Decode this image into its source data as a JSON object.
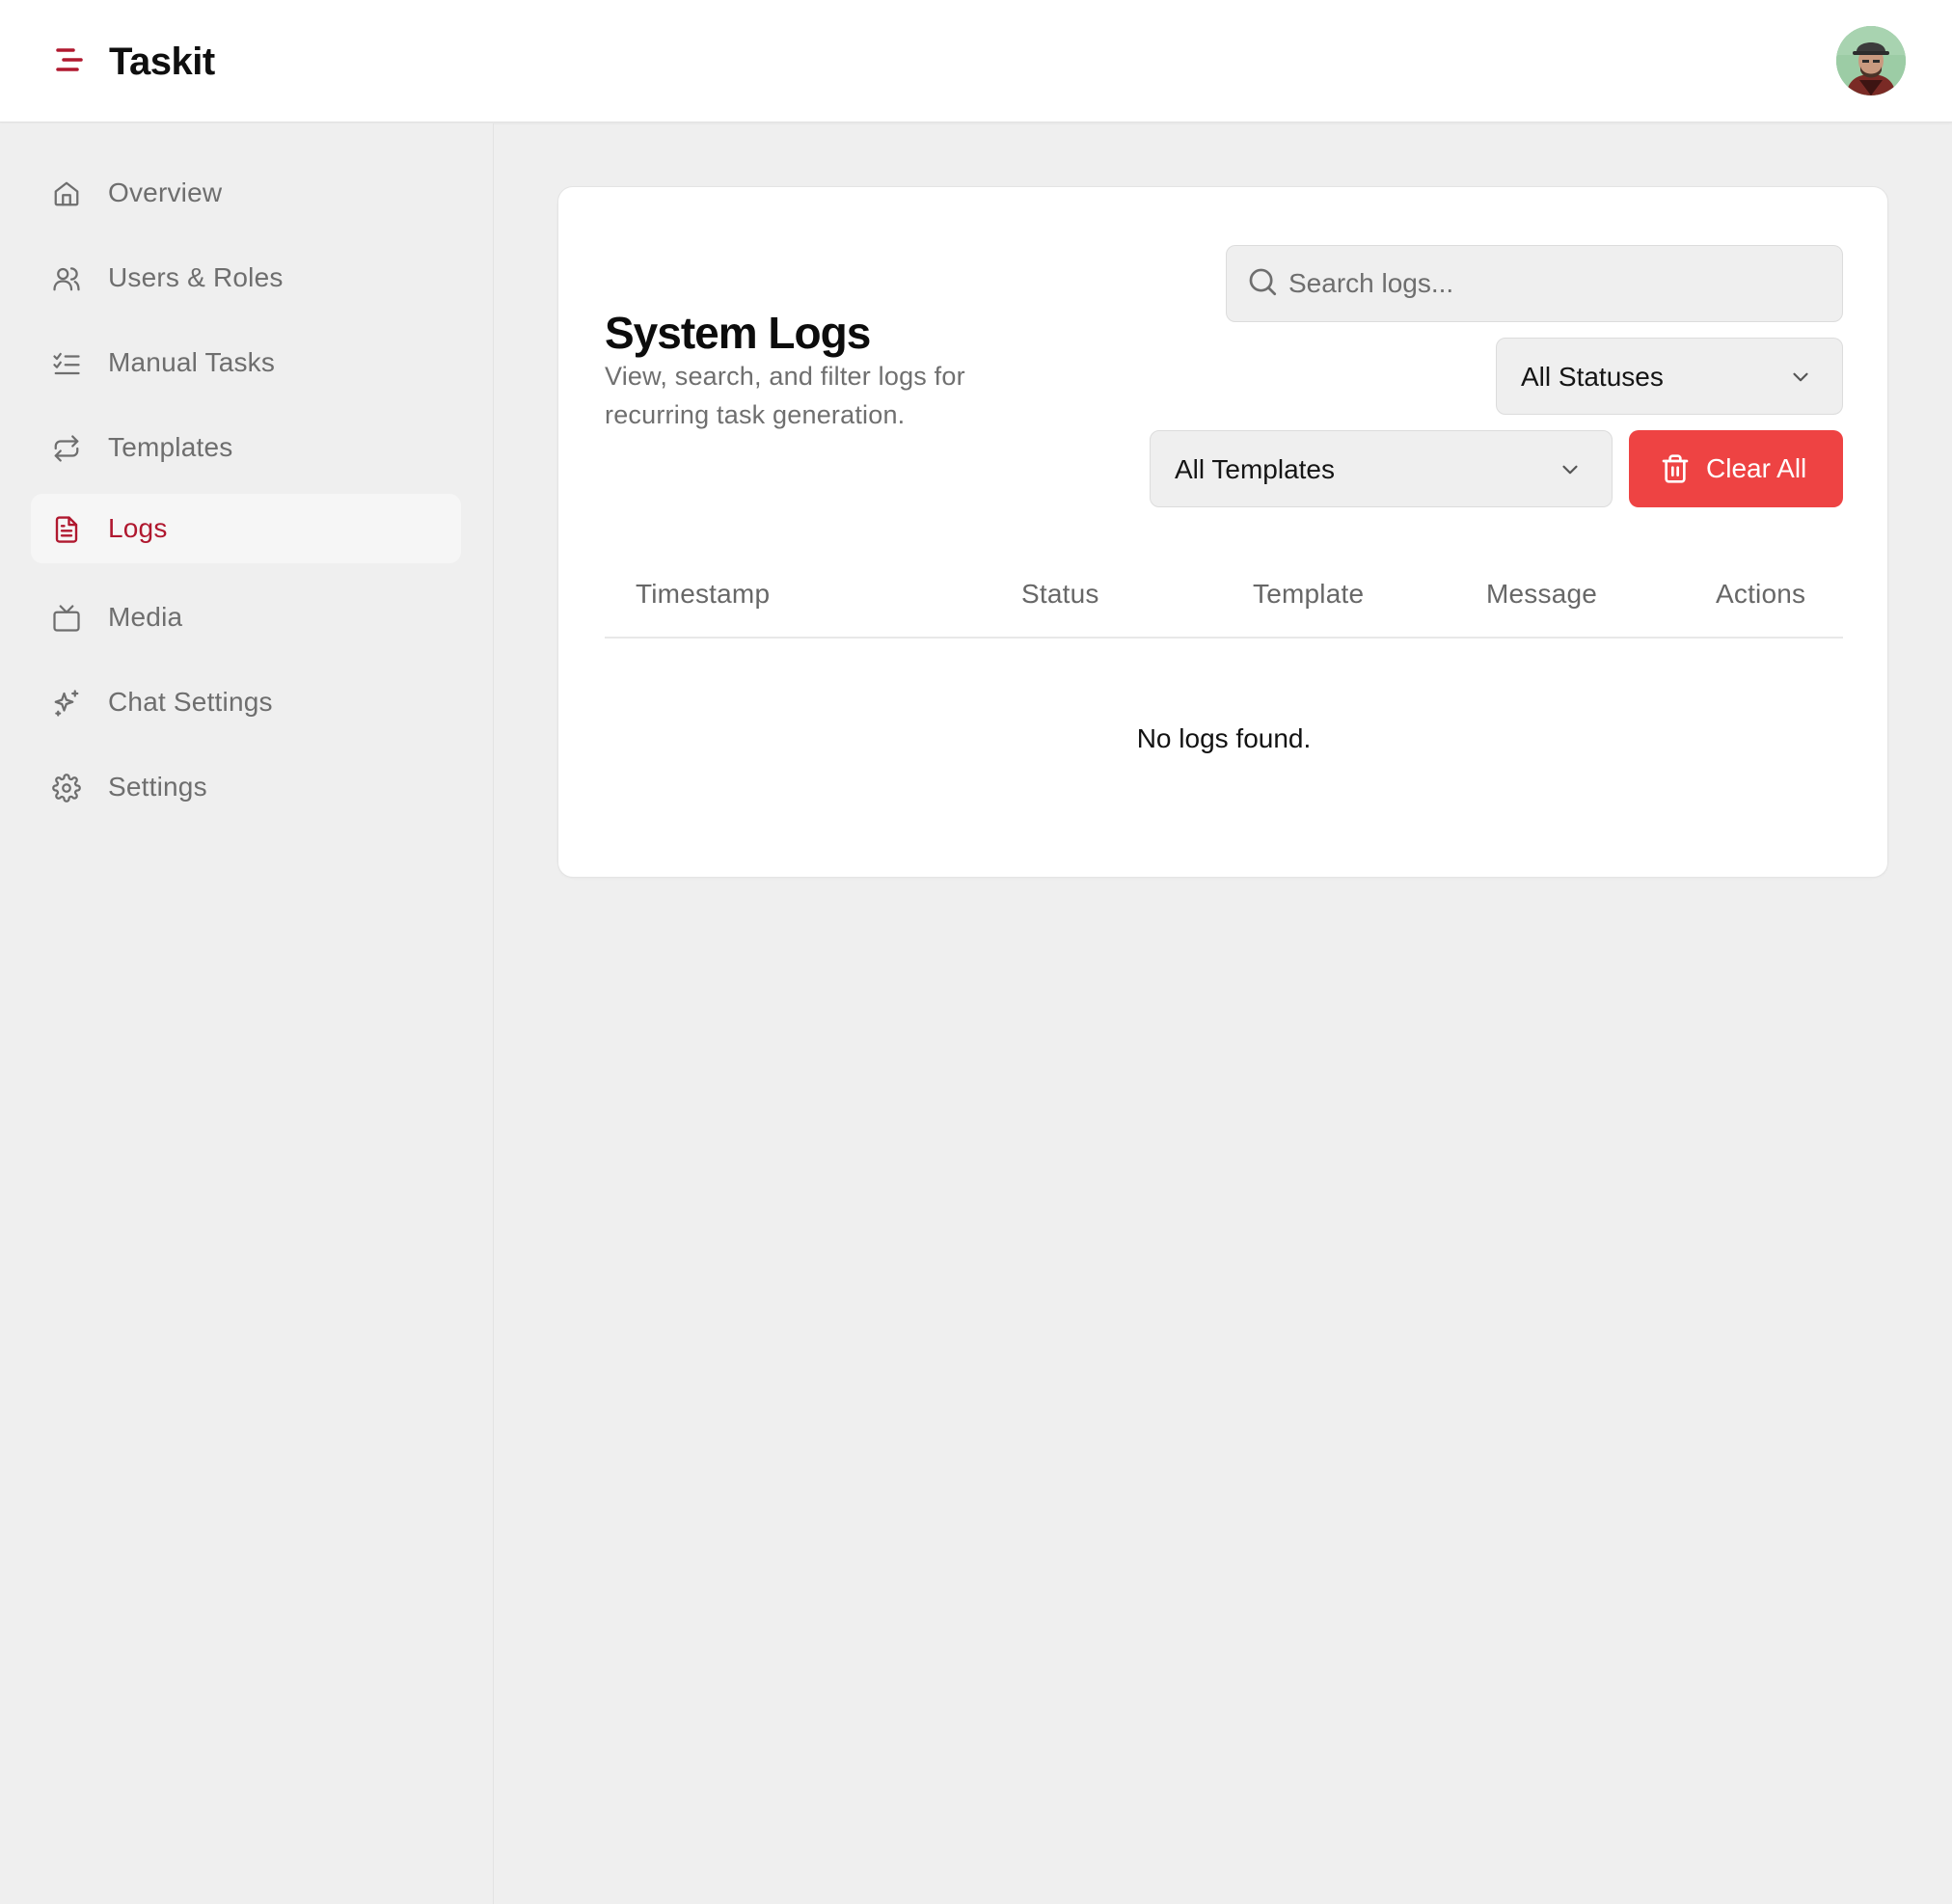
{
  "app": {
    "name": "Taskit"
  },
  "header": {
    "menu_icon": "menu-icon",
    "avatar_alt": "user-avatar"
  },
  "sidebar": {
    "items": [
      {
        "label": "Overview",
        "icon": "home-icon",
        "active": false
      },
      {
        "label": "Users & Roles",
        "icon": "users-icon",
        "active": false
      },
      {
        "label": "Manual Tasks",
        "icon": "list-checks-icon",
        "active": false
      },
      {
        "label": "Templates",
        "icon": "repeat-icon",
        "active": false
      },
      {
        "label": "Logs",
        "icon": "file-text-icon",
        "active": true
      },
      {
        "label": "Media",
        "icon": "tv-icon",
        "active": false
      },
      {
        "label": "Chat Settings",
        "icon": "sparkles-icon",
        "active": false
      },
      {
        "label": "Settings",
        "icon": "gear-icon",
        "active": false
      }
    ]
  },
  "main": {
    "title": "System Logs",
    "description": "View, search, and filter logs for recurring task generation.",
    "search": {
      "placeholder": "Search logs...",
      "value": ""
    },
    "status_filter": {
      "selected": "All Statuses"
    },
    "template_filter": {
      "selected": "All Templates"
    },
    "clear_button": {
      "label": "Clear All"
    },
    "table": {
      "columns": [
        "Timestamp",
        "Status",
        "Template",
        "Message",
        "Actions"
      ],
      "rows": [],
      "empty_message": "No logs found."
    }
  },
  "colors": {
    "accent": "#b0182f",
    "danger": "#ee4343",
    "background": "#efefef",
    "surface": "#ffffff",
    "muted_text": "#6e6e6e"
  }
}
